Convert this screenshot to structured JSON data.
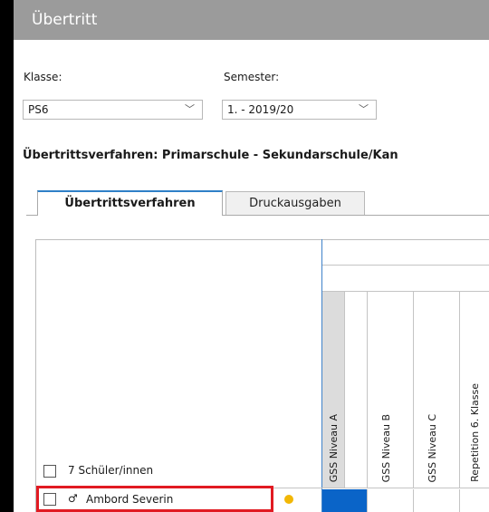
{
  "window": {
    "title": "Übertritt"
  },
  "filters": {
    "class_label": "Klasse:",
    "class_value": "PS6",
    "semester_label": "Semester:",
    "semester_value": "1. - 2019/20"
  },
  "procedure_heading": "Übertrittsverfahren:  Primarschule - Sekundarschule/Kan",
  "tabs": [
    {
      "label": "Übertrittsverfahren",
      "active": true
    },
    {
      "label": "Druckausgaben",
      "active": false
    }
  ],
  "grid": {
    "columns": [
      "GSS Niveau A",
      "GSS Niveau B",
      "GSS Niveau C",
      "Repetition 6. Klasse"
    ],
    "summary_label": "7 Schüler/innen",
    "rows": [
      {
        "gender_symbol": "♂",
        "name": "Ambord Severin",
        "status_color": "#f2b705"
      }
    ]
  },
  "colors": {
    "selected_cell": "#0a64c8",
    "highlight": "#e11a22",
    "tab_accent": "#2f80c7"
  },
  "icons": {
    "dropdown": "chevron-down-icon",
    "gender": "male-icon",
    "status": "status-dot-icon"
  }
}
